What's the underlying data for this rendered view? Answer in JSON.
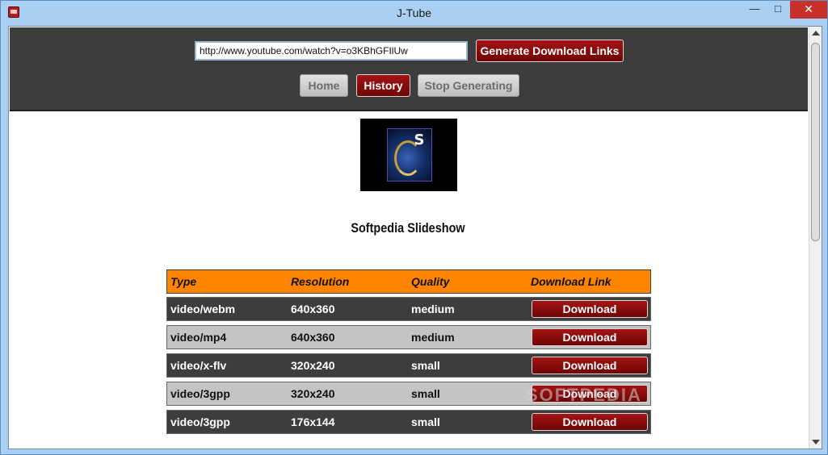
{
  "window": {
    "title": "J-Tube",
    "minimize_glyph": "—",
    "maximize_glyph": "□",
    "close_glyph": "✕"
  },
  "header": {
    "url_value": "http://www.youtube.com/watch?v=o3KBhGFIlUw",
    "generate_label": "Generate Download Links",
    "home_label": "Home",
    "history_label": "History",
    "stop_label": "Stop Generating"
  },
  "video": {
    "title": "Softpedia Slideshow",
    "thumbnail_letter": "S"
  },
  "table": {
    "headers": [
      "Type",
      "Resolution",
      "Quality",
      "Download Link"
    ],
    "rows": [
      {
        "type": "video/webm",
        "resolution": "640x360",
        "quality": "medium",
        "link": "Download"
      },
      {
        "type": "video/mp4",
        "resolution": "640x360",
        "quality": "medium",
        "link": "Download"
      },
      {
        "type": "video/x-flv",
        "resolution": "320x240",
        "quality": "small",
        "link": "Download"
      },
      {
        "type": "video/3gpp",
        "resolution": "320x240",
        "quality": "small",
        "link": "Download"
      },
      {
        "type": "video/3gpp",
        "resolution": "176x144",
        "quality": "small",
        "link": "Download"
      }
    ]
  },
  "watermark": "SOFTPEDIA",
  "colors": {
    "header_bg": "#3d3d3d",
    "accent_red": "#8b0b0b",
    "table_header": "#ff8400",
    "row_dark": "#3d3d3d",
    "row_light": "#c4c4c4"
  }
}
